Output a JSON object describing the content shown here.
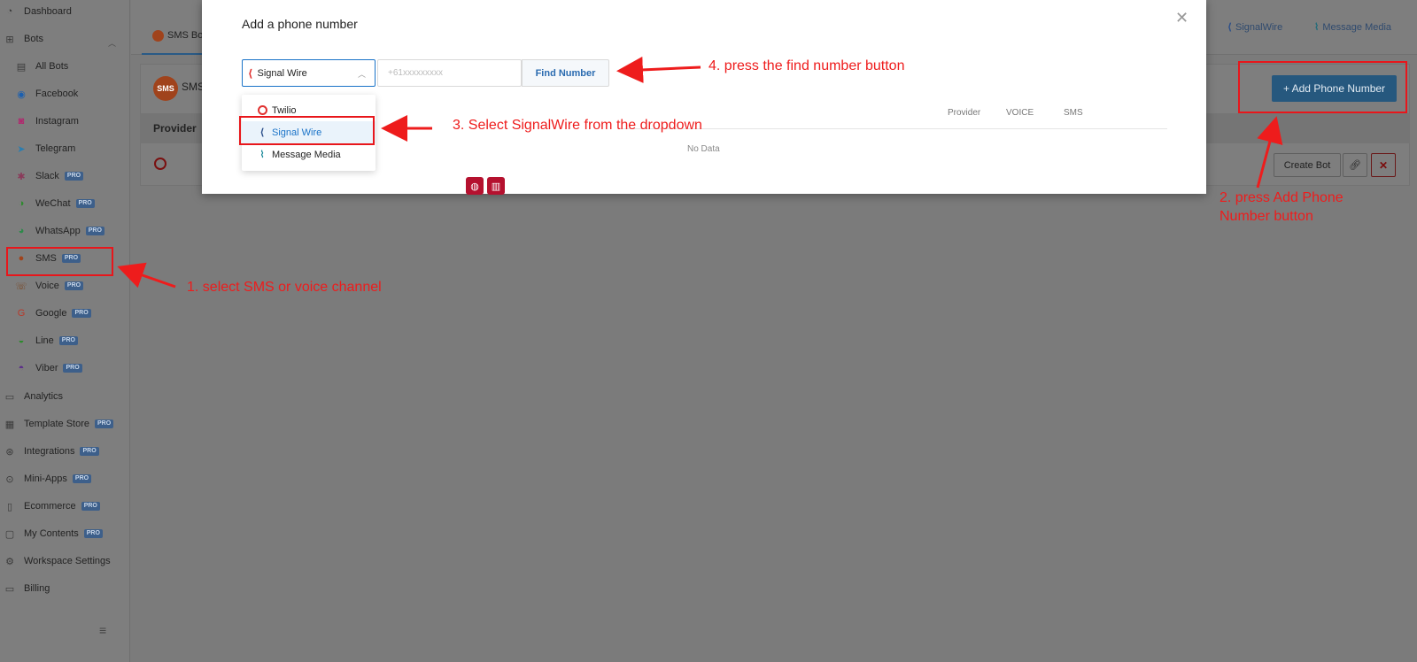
{
  "sidebar": {
    "items": [
      {
        "label": "Dashboard",
        "icon": "dashboard-icon",
        "pro": false
      },
      {
        "label": "Bots",
        "icon": "sitemap-icon",
        "pro": false
      },
      {
        "label": "All Bots",
        "icon": "list-icon",
        "pro": false
      },
      {
        "label": "Facebook",
        "icon": "messenger-icon",
        "pro": false
      },
      {
        "label": "Instagram",
        "icon": "instagram-icon",
        "pro": false
      },
      {
        "label": "Telegram",
        "icon": "telegram-icon",
        "pro": false
      },
      {
        "label": "Slack",
        "icon": "slack-icon",
        "pro": true
      },
      {
        "label": "WeChat",
        "icon": "wechat-icon",
        "pro": true
      },
      {
        "label": "WhatsApp",
        "icon": "whatsapp-icon",
        "pro": true
      },
      {
        "label": "SMS",
        "icon": "sms-icon",
        "pro": true
      },
      {
        "label": "Voice",
        "icon": "phone-icon",
        "pro": true
      },
      {
        "label": "Google",
        "icon": "google-icon",
        "pro": true
      },
      {
        "label": "Line",
        "icon": "line-icon",
        "pro": true
      },
      {
        "label": "Viber",
        "icon": "viber-icon",
        "pro": true
      },
      {
        "label": "Analytics",
        "icon": "chat-icon",
        "pro": false
      },
      {
        "label": "Template Store",
        "icon": "store-icon",
        "pro": true
      },
      {
        "label": "Integrations",
        "icon": "integrations-icon",
        "pro": true
      },
      {
        "label": "Mini-Apps",
        "icon": "mini-apps-icon",
        "pro": true
      },
      {
        "label": "Ecommerce",
        "icon": "document-icon",
        "pro": true
      },
      {
        "label": "My Contents",
        "icon": "contents-icon",
        "pro": true
      },
      {
        "label": "Workspace Settings",
        "icon": "gear-icon",
        "pro": false
      },
      {
        "label": "Billing",
        "icon": "card-icon",
        "pro": false
      }
    ],
    "pro_label": "PRO"
  },
  "topbar": {
    "sms_tab": "SMS Bo",
    "right_tabs": [
      "SignalWire",
      "Message Media"
    ]
  },
  "card": {
    "badge": "SMS",
    "title": "SMS",
    "provider_column": "Provider",
    "add_phone_button": "+ Add Phone Number",
    "create_bot_button": "Create Bot"
  },
  "modal": {
    "title": "Add a phone number",
    "select_value": "Signal Wire",
    "phone_placeholder": "+61xxxxxxxxx",
    "find_button": "Find Number",
    "dropdown_options": [
      "Twilio",
      "Signal Wire",
      "Message Media"
    ],
    "table_headers": [
      "Provider",
      "VOICE",
      "SMS"
    ],
    "empty_text": "No Data"
  },
  "annotations": {
    "step1": "1. select SMS or voice channel",
    "step2_line1": "2. press Add Phone",
    "step2_line2": "Number button",
    "step3": "3. Select SignalWire from the dropdown",
    "step4": "4. press the find number button"
  },
  "colors": {
    "annotation_red": "#ee1c1c",
    "primary_blue": "#1a73c8",
    "danger": "#b5112f"
  }
}
